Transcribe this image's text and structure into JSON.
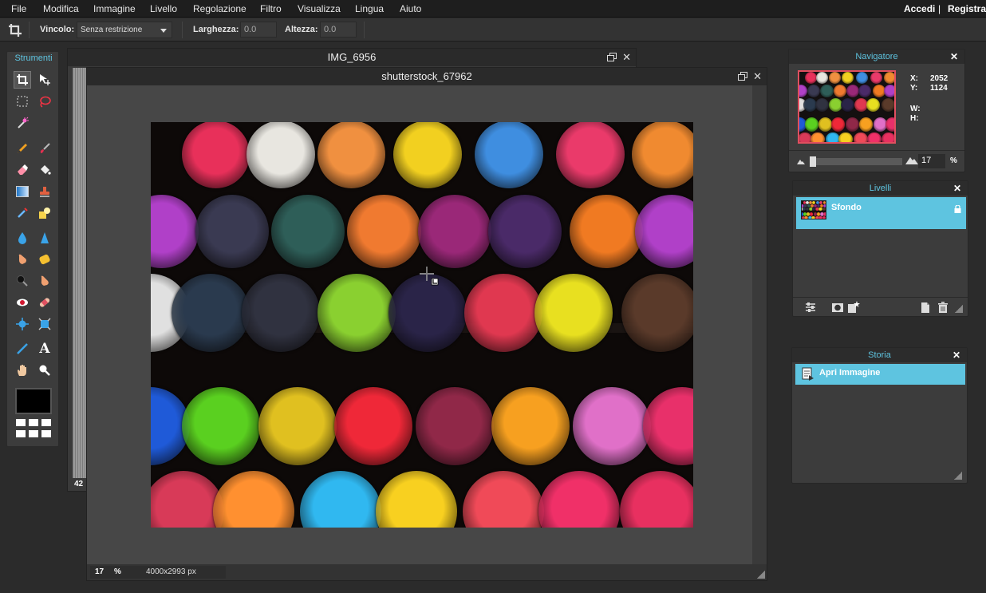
{
  "menu": {
    "items": [
      "File",
      "Modifica",
      "Immagine",
      "Livello",
      "Regolazione",
      "Filtro",
      "Visualizza",
      "Lingua",
      "Aiuto"
    ],
    "login": "Accedi",
    "divider": "|",
    "register": "Registrat"
  },
  "options": {
    "constraint_label": "Vincolo:",
    "constraint_value": "Senza restrizione",
    "width_label": "Larghezza:",
    "width_value": "0.0",
    "height_label": "Altezza:",
    "height_value": "0.0"
  },
  "tools": {
    "title": "Strumenti",
    "foreground_color": "#000000"
  },
  "documents": {
    "back": {
      "title": "IMG_6956",
      "zoom": "42"
    },
    "front": {
      "title": "shutterstock_67962",
      "zoom": "17",
      "zoom_unit": "%",
      "dimensions": "4000x2993 px"
    }
  },
  "navigator": {
    "title": "Navigatore",
    "x_label": "X:",
    "x_value": "2052",
    "y_label": "Y:",
    "y_value": "1124",
    "w_label": "W:",
    "h_label": "H:",
    "zoom": "17",
    "zoom_unit": "%",
    "zoom_fraction": 0.0
  },
  "layers": {
    "title": "Livelli",
    "items": [
      {
        "name": "Sfondo",
        "locked": true
      }
    ]
  },
  "history": {
    "title": "Storia",
    "items": [
      {
        "name": "Apri Immagine"
      }
    ]
  },
  "colors": {
    "accent": "#5ec4e0",
    "background": "#2b2b2b",
    "panel": "#3c3c3c"
  },
  "close_glyph": "✕"
}
